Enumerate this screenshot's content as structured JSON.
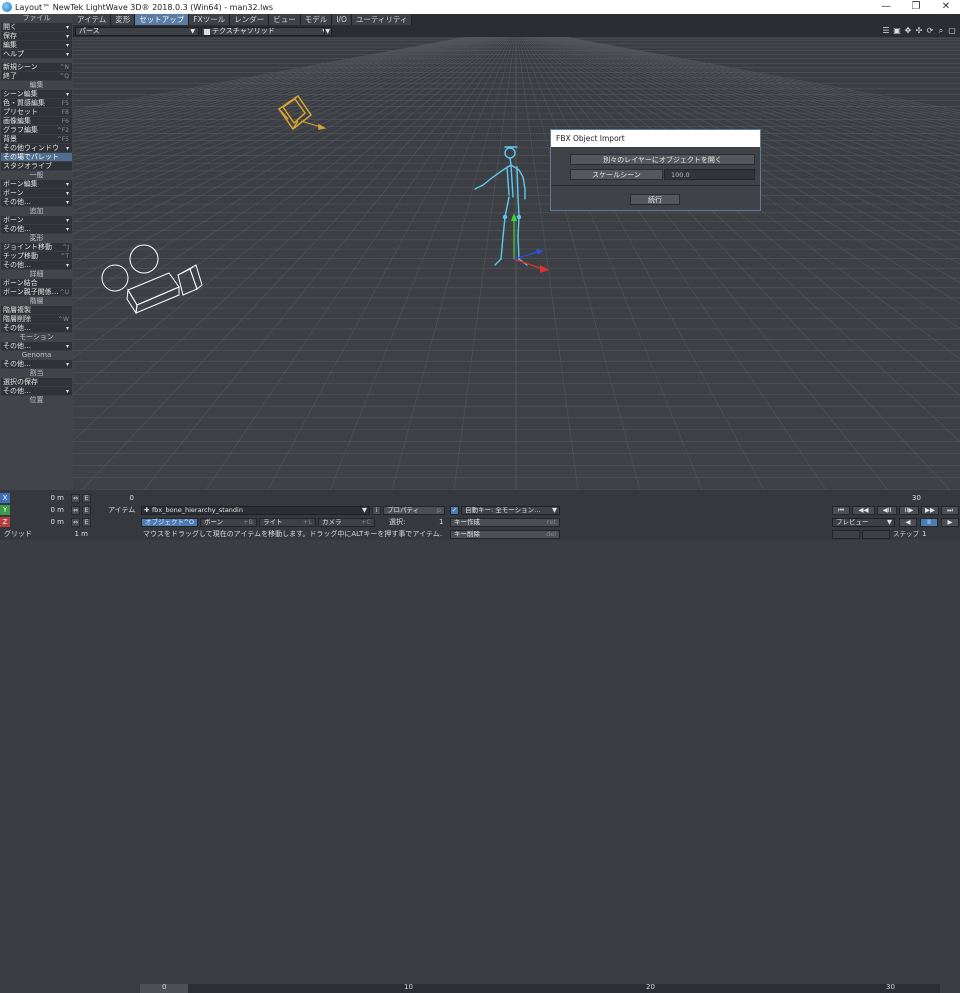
{
  "window": {
    "title": "Layout™ NewTek LightWave 3D® 2018.0.3 (Win64) - man32.lws",
    "min": "—",
    "max": "❐",
    "close": "✕"
  },
  "tabs": [
    "アイテム",
    "変形",
    "セットアップ",
    "FXツール",
    "レンダー",
    "ビュー",
    "モデル",
    "I/O",
    "ユーティリティ"
  ],
  "active_tab": "セットアップ",
  "viewport_bar": {
    "view": "パース",
    "render_mode": "テクスチャソリッド"
  },
  "sidebar": {
    "file_header": "ファイル",
    "file_items": [
      {
        "label": "開く",
        "dd": "▾"
      },
      {
        "label": "保存",
        "dd": "▾"
      },
      {
        "label": "編集",
        "dd": "▾"
      },
      {
        "label": "ヘルプ",
        "dd": "▾"
      }
    ],
    "scene_items": [
      {
        "label": "新規シーン",
        "sc": "^N"
      },
      {
        "label": "終了",
        "sc": "^Q"
      }
    ],
    "edit_header": "編集",
    "edit_items": [
      {
        "label": "シーン編集",
        "dd": "▾"
      },
      {
        "label": "色・質感編集",
        "sc": "F5"
      },
      {
        "label": "プリセット",
        "sc": "F8"
      },
      {
        "label": "画像編集",
        "sc": "F6"
      },
      {
        "label": "グラフ編集",
        "sc": "^F2"
      },
      {
        "label": "背景",
        "sc": "^F5"
      },
      {
        "label": "その他ウィンドウ",
        "dd": "▾"
      },
      {
        "label": "その場でパレット",
        "sel": true
      },
      {
        "label": "スタジオライブ"
      }
    ],
    "general_header": "一般",
    "general_items": [
      {
        "label": "ボーン編集",
        "dd": "▾"
      },
      {
        "label": "ボーン",
        "dd": "▾"
      },
      {
        "label": "その他…",
        "dd": "▾"
      }
    ],
    "add_header": "追加",
    "add_items": [
      {
        "label": "ボーン",
        "dd": "▾"
      },
      {
        "label": "その他…",
        "dd": "▾"
      }
    ],
    "transform_header": "変形",
    "transform_items": [
      {
        "label": "ジョイント移動",
        "sc": "^J"
      },
      {
        "label": "チップ移動",
        "sc": "^T"
      },
      {
        "label": "その他…",
        "dd": "▾"
      }
    ],
    "detail_header": "詳細",
    "detail_items": [
      {
        "label": "ボーン結合"
      },
      {
        "label": "ボーン親子関係…",
        "sc": "^U"
      }
    ],
    "hier_header": "階層",
    "hier_items": [
      {
        "label": "階層複製"
      },
      {
        "label": "階層削除",
        "sc": "^W"
      },
      {
        "label": "その他…",
        "dd": "▾"
      }
    ],
    "motion_header": "モーション",
    "motion_items": [
      {
        "label": "その他…",
        "dd": "▾"
      }
    ],
    "genoma_header": "Genoma",
    "genoma_items": [
      {
        "label": "その他…",
        "dd": "▾"
      }
    ],
    "assign_header": "割当",
    "assign_items": [
      {
        "label": "選択の保存"
      },
      {
        "label": "その他…",
        "dd": "▾"
      }
    ],
    "position_header": "位置"
  },
  "dialog": {
    "title": "FBX Object Import",
    "btn_layers": "別々のレイヤーにオブジェクトを開く",
    "btn_scale": "スケールシーン",
    "scale_value": "100.0",
    "btn_continue": "続行"
  },
  "timeline": {
    "x_label": "X",
    "y_label": "Y",
    "z_label": "Z",
    "x_val": "0 m",
    "y_val": "0 m",
    "z_val": "0 m",
    "grid_label": "グリッド",
    "grid_val": "1 m",
    "frame": "0",
    "ticks": [
      "0",
      "10",
      "20",
      "30"
    ],
    "end_frame": "30",
    "item_label": "アイテム",
    "item_value": "fbx_bone_hierarchy_standin",
    "prop_label": "プロパティ",
    "prop_sc": "p",
    "autokey_label": "自動キー: 全モーション…",
    "obj_label": "オブジェクト",
    "obj_sc": "^O",
    "bone_label": "ボーン",
    "bone_sc": "+B",
    "light_label": "ライト",
    "light_sc": "+L",
    "camera_label": "カメラ",
    "camera_sc": "+C",
    "select_label": "選択:",
    "select_val": "1",
    "keycreate_label": "キー作成",
    "keycreate_sc": "ret",
    "keydelete_label": "キー削除",
    "keydelete_sc": "del",
    "status": "マウスをドラッグして現在のアイテムを移動します。ドラッグ中にALTキーを押す事でアイテム…",
    "preview_label": "プレビュー",
    "step_label": "ステップ",
    "step_val": "1",
    "transport": [
      "⏮",
      "◀◀",
      "◀II",
      "II▶",
      "▶▶",
      "⏭"
    ],
    "play": [
      "◀",
      "II",
      "▶"
    ]
  },
  "colors": {
    "accent": "#5a7da3",
    "camera": "#ffffff",
    "light": "#d9a531",
    "skeleton": "#5fc8f0"
  }
}
